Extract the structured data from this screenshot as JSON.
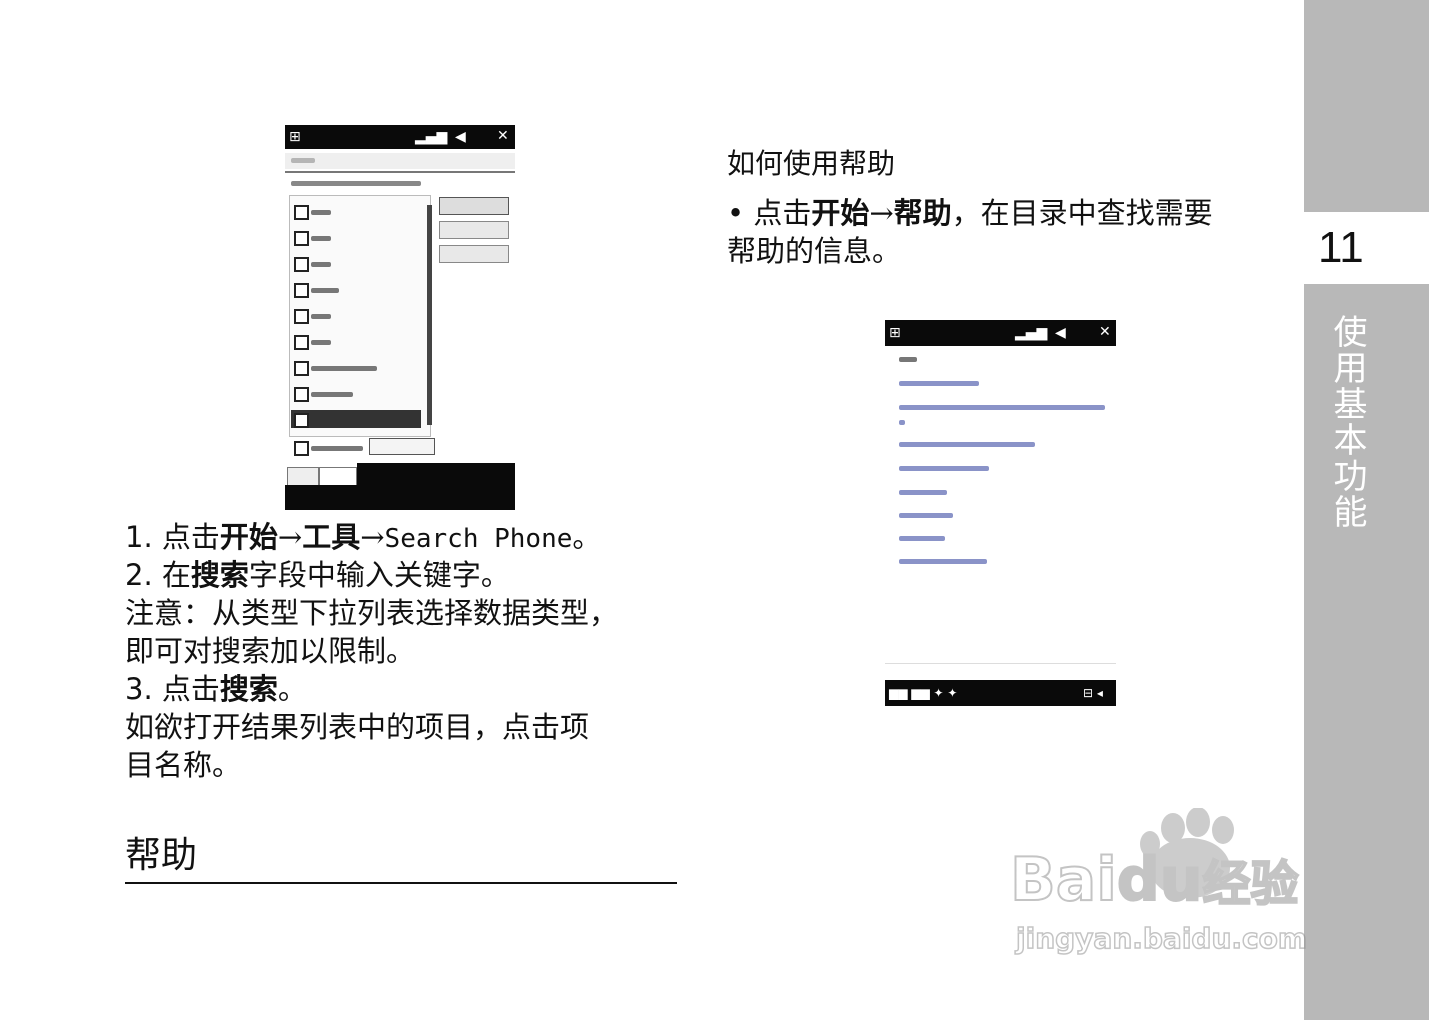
{
  "sidebar": {
    "page_number": "11",
    "section_label": "使用基本功能"
  },
  "left_column": {
    "step1": {
      "prefix": "1. 点击",
      "bold1": "开始",
      "arrow1": "→",
      "bold2": "工具",
      "arrow2": "→",
      "mono": "Search Phone",
      "end": "。"
    },
    "step2": {
      "prefix": "2. 在",
      "bold": "搜索",
      "rest": "字段中输入关键字。"
    },
    "note_line1": "注意：从类型下拉列表选择数据类型，",
    "note_line2": "即可对搜索加以限制。",
    "step3": {
      "prefix": "3. 点击",
      "bold": "搜索",
      "end": "。"
    },
    "open_line1": "如欲打开结果列表中的项目，点击项",
    "open_line2": "目名称。",
    "section_heading": "帮助"
  },
  "right_column": {
    "subheading": "如何使用帮助",
    "bullet": {
      "marker": "•",
      "prefix": " 点击",
      "bold1": "开始",
      "arrow": "→",
      "bold2": "帮助",
      "rest": "，在目录中查找需要"
    },
    "bullet_line2": "帮助的信息。"
  },
  "watermark": {
    "brand_a": "Bai",
    "brand_b": "du",
    "brand_cn": "经验",
    "url": "jingyan.baidu.com"
  },
  "icons": [
    "windows-start-icon",
    "signal-icon",
    "volume-icon",
    "close-icon",
    "checkbox-icon",
    "paw-icon"
  ]
}
